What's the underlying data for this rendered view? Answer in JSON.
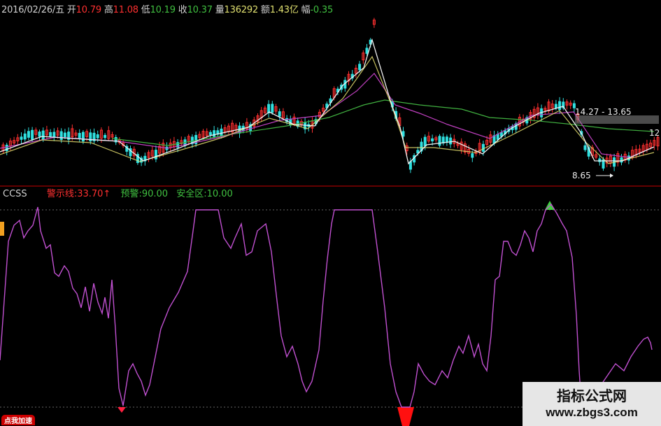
{
  "info_bar": {
    "date": "2016/02/26/五",
    "open_label": "开",
    "open": "10.79",
    "high_label": "高",
    "high": "11.08",
    "low_label": "低",
    "low": "10.19",
    "close_label": "收",
    "close": "10.37",
    "volume_label": "量",
    "volume": "136292",
    "amount_label": "额",
    "amount": "1.43亿",
    "change_label": "幅",
    "change": "-0.35"
  },
  "indicator": {
    "name": "CCSS",
    "warn_line_label": "警示线:",
    "warn_line_value": "33.70",
    "warn_arrow": "↑",
    "alert_label": "预警:",
    "alert_value": "90.00",
    "safe_label": "安全区:",
    "safe_value": "10.00"
  },
  "annotations": {
    "range_label": "14.27 - 13.65",
    "low_label": "8.65",
    "right_value": "12"
  },
  "watermark": {
    "line1": "指标公式网",
    "line2": "www.zbgs3.com"
  },
  "badge_text": "点我加速",
  "colors": {
    "background": "#000000",
    "up": "#ff3030",
    "down": "#30e0e0",
    "ma_white": "#f0f0f0",
    "ma_yellow": "#e8e070",
    "ma_purple": "#c040c0",
    "ma_green": "#40b040",
    "indicator_line": "#c050d0",
    "divider": "#a00000",
    "label_red": "#ff3030",
    "label_green": "#40c040",
    "label_gray": "#d0d0d0"
  }
}
